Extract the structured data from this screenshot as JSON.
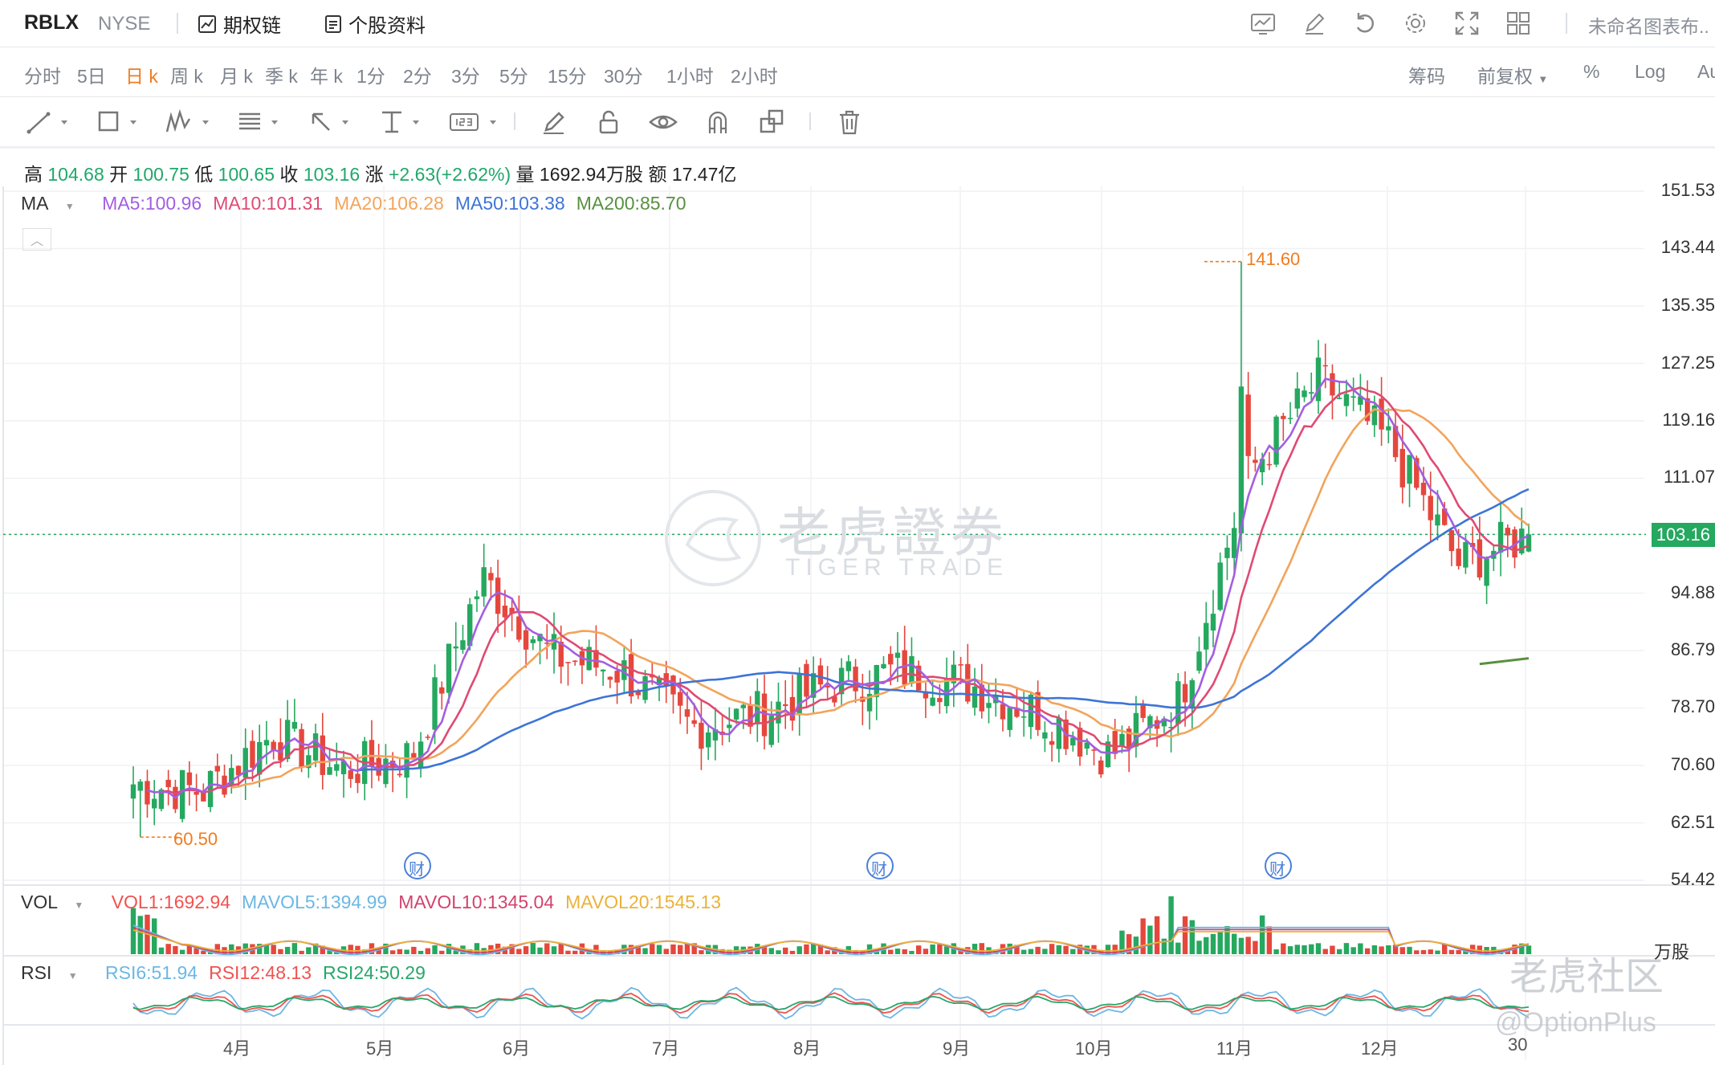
{
  "header": {
    "ticker": "RBLX",
    "exchange": "NYSE",
    "options_chain": "期权链",
    "stock_profile": "个股资料",
    "chart_name": "未命名图表布.."
  },
  "periods": [
    "分时",
    "5日",
    "日 k",
    "周 k",
    "月 k",
    "季 k",
    "年 k",
    "1分",
    "2分",
    "3分",
    "5分",
    "15分",
    "30分",
    "1小时",
    "2小时"
  ],
  "active_period": "日 k",
  "right_options": {
    "chips": "筹码",
    "adjust": "前复权",
    "percent": "%",
    "log": "Log",
    "auto": "Au"
  },
  "info": {
    "high_label": "高",
    "high": "104.68",
    "open_label": "开",
    "open": "100.75",
    "low_label": "低",
    "low": "100.65",
    "close_label": "收",
    "close": "103.16",
    "change_label": "涨",
    "change": "+2.63(+2.62%)",
    "volume_label": "量",
    "volume": "1692.94万股",
    "amount_label": "额",
    "amount": "17.47亿"
  },
  "ma_legend": {
    "label": "MA",
    "items": [
      {
        "text": "MA5:100.96",
        "color": "#a35ee0"
      },
      {
        "text": "MA10:101.31",
        "color": "#df4a73"
      },
      {
        "text": "MA20:106.28",
        "color": "#f2a45c"
      },
      {
        "text": "MA50:103.38",
        "color": "#3e74d6"
      },
      {
        "text": "MA200:85.70",
        "color": "#58913f"
      }
    ]
  },
  "vol_legend": {
    "label": "VOL",
    "items": [
      {
        "text": "VOL1:1692.94",
        "color": "#ef5350"
      },
      {
        "text": "MAVOL5:1394.99",
        "color": "#6cb7e4"
      },
      {
        "text": "MAVOL10:1345.04",
        "color": "#d2436d"
      },
      {
        "text": "MAVOL20:1545.13",
        "color": "#ebb23a"
      }
    ],
    "unit": "万股"
  },
  "rsi_legend": {
    "label": "RSI",
    "items": [
      {
        "text": "RSI6:51.94",
        "color": "#6cb7e4"
      },
      {
        "text": "RSI12:48.13",
        "color": "#ef5350"
      },
      {
        "text": "RSI24:50.29",
        "color": "#27a76b"
      }
    ]
  },
  "y_ticks": [
    "151.53",
    "143.44",
    "135.35",
    "127.25",
    "119.16",
    "111.07",
    "103.16",
    "94.88",
    "86.79",
    "78.70",
    "70.60",
    "62.51",
    "54.42"
  ],
  "x_ticks": [
    "4月",
    "5月",
    "6月",
    "7月",
    "8月",
    "9月",
    "10月",
    "11月",
    "12月",
    "30"
  ],
  "annotations": {
    "high": "141.60",
    "low": "60.50",
    "current": "103.16",
    "earnings": "财"
  },
  "colors": {
    "up": "#25a85f",
    "down": "#e5473d",
    "accent": "#f07c1f",
    "ma5": "#a35ee0",
    "ma10": "#df4a73",
    "ma20": "#f2a45c",
    "ma50": "#3e74d6",
    "ma200": "#58913f"
  },
  "watermark": {
    "cn": "老虎證券",
    "en": "TIGER TRADE",
    "community": "老虎社区",
    "user": "@OptionPlus"
  },
  "chart_data": {
    "type": "candlestick",
    "ylim": [
      54.42,
      151.53
    ],
    "highest": 141.6,
    "lowest": 60.5,
    "last_close": 103.16,
    "series": [
      {
        "name": "MA5",
        "values": [
          100.96
        ]
      },
      {
        "name": "MA10",
        "values": [
          101.31
        ]
      },
      {
        "name": "MA20",
        "values": [
          106.28
        ]
      },
      {
        "name": "MA50",
        "values": [
          103.38
        ]
      },
      {
        "name": "MA200",
        "values": [
          85.7
        ]
      }
    ],
    "anchors": [
      {
        "month": "3月中",
        "close": 68
      },
      {
        "month": "4月初",
        "close": 67
      },
      {
        "month": "4月中",
        "close": 75
      },
      {
        "month": "5月初",
        "close": 70
      },
      {
        "month": "5月中",
        "close": 72
      },
      {
        "month": "6月初",
        "close": 97
      },
      {
        "month": "6月中",
        "close": 86
      },
      {
        "month": "7月初",
        "close": 84
      },
      {
        "month": "7月中",
        "close": 76
      },
      {
        "month": "8月初",
        "close": 78
      },
      {
        "month": "8月中",
        "close": 82
      },
      {
        "month": "9月初",
        "close": 84
      },
      {
        "month": "9月中",
        "close": 82
      },
      {
        "month": "10月初",
        "close": 78
      },
      {
        "month": "10月中",
        "close": 72
      },
      {
        "month": "11月初",
        "close": 80
      },
      {
        "month": "11月中",
        "close": 112
      },
      {
        "month": "11月下",
        "close": 125
      },
      {
        "month": "12月中",
        "close": 116
      },
      {
        "month": "12月下",
        "close": 99
      },
      {
        "month": "12月30",
        "close": 103.16
      }
    ]
  }
}
